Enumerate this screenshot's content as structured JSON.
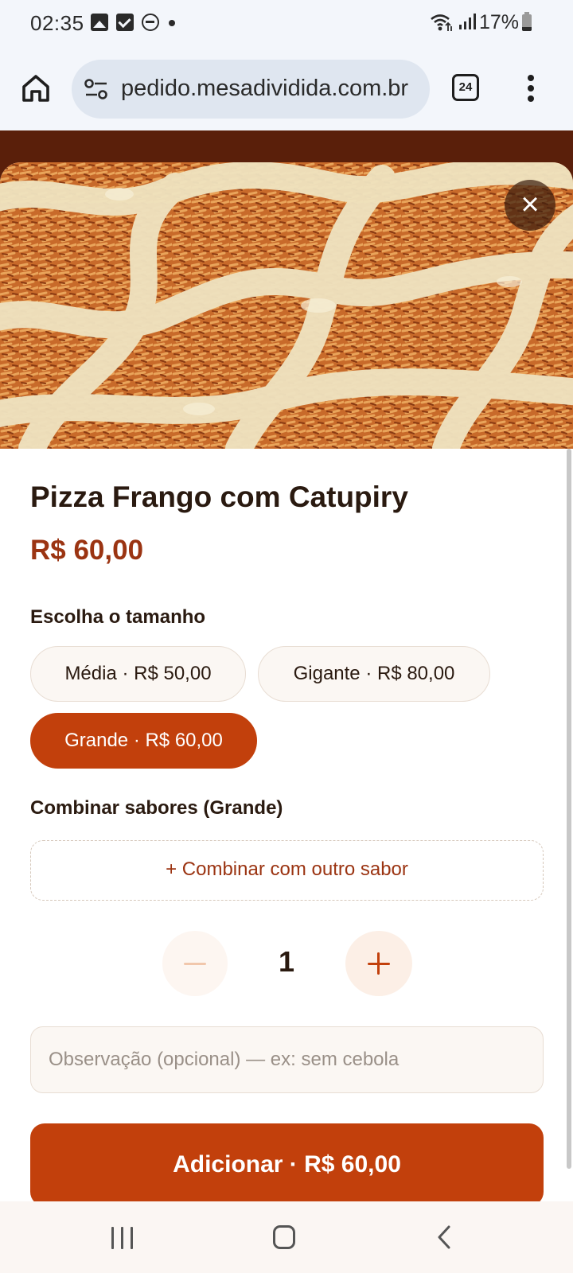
{
  "status_bar": {
    "time": "02:35",
    "battery": "17%",
    "icons": [
      "gallery-icon",
      "checkbox-icon",
      "do-not-disturb-icon",
      "dot-icon",
      "wifi-icon",
      "signal-icon",
      "battery-icon"
    ]
  },
  "browser": {
    "url": "pedido.mesadividida.com.br",
    "tab_count": "24",
    "icons": [
      "home-icon",
      "tune-icon",
      "tab-switcher-icon",
      "more-vert-icon"
    ]
  },
  "product": {
    "title": "Pizza Frango com Catupiry",
    "price": "R$ 60,00",
    "image": "pizza-photo"
  },
  "sizes": {
    "label": "Escolha o tamanho",
    "options": [
      {
        "label": "Média · R$ 50,00",
        "selected": false
      },
      {
        "label": "Gigante · R$ 80,00",
        "selected": false
      },
      {
        "label": "Grande · R$ 60,00",
        "selected": true
      }
    ]
  },
  "combine": {
    "label": "Combinar sabores (Grande)",
    "button": "+ Combinar com outro sabor"
  },
  "quantity": {
    "value": "1"
  },
  "note": {
    "placeholder": "Observação (opcional) — ex: sem cebola",
    "value": ""
  },
  "add_button": "Adicionar · R$ 60,00",
  "colors": {
    "accent": "#c2400c",
    "price": "#9b3412",
    "header_bg": "#5a1f0a",
    "chip_bg": "#fbf7f3"
  }
}
